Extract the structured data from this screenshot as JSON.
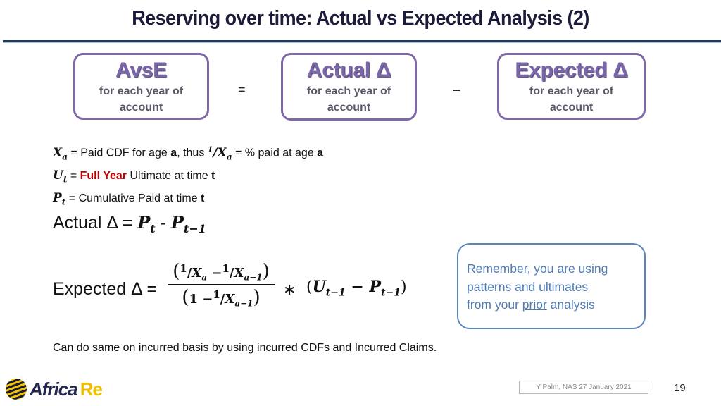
{
  "slide": {
    "title": "Reserving over time: Actual vs Expected Analysis (2)",
    "boxes": [
      {
        "title": "AvsE",
        "subtitle_line1": "for each year of",
        "subtitle_line2": "account"
      },
      {
        "title": "Actual Δ",
        "subtitle_line1": "for each year of",
        "subtitle_line2": "account"
      },
      {
        "title": "Expected Δ",
        "subtitle_line1": "for each year of",
        "subtitle_line2": "account"
      }
    ],
    "operators": {
      "equals": "=",
      "minus": "–"
    },
    "definitions": [
      {
        "symbol": "X",
        "subscript": "a",
        "text1": " = Paid CDF for age ",
        "bold1": "a",
        "text2": ", thus ",
        "frac_num": "1",
        "frac_sym": "X",
        "frac_sub": "a",
        "text3": " = % paid at age ",
        "bold2": "a"
      },
      {
        "symbol": "U",
        "subscript": "t",
        "text1": " = ",
        "highlight": "Full Year",
        "text2": " Ultimate at time ",
        "bold1": "t"
      },
      {
        "symbol": "P",
        "subscript": "t",
        "text1": " = Cumulative Paid at time ",
        "bold1": "t"
      }
    ],
    "actual_formula": {
      "label": "Actual Δ = ",
      "term1": "P",
      "term1_sub": "t",
      "op": " - ",
      "term2": "P",
      "term2_sub": "t−1"
    },
    "expected_formula": {
      "label": "Expected Δ = ",
      "numerator": {
        "open": "(",
        "one_a": "1",
        "x_a": "X",
        "sub_a": "a",
        "minus": " −",
        "one_b": "1",
        "x_b": "X",
        "sub_b": "a−1",
        "close": ")"
      },
      "denominator": {
        "open": "(",
        "one": "1",
        "minus": " −",
        "one_b": "1",
        "x": "X",
        "sub": "a−1",
        "close": ")"
      },
      "times": "∗",
      "paren": {
        "open": "(",
        "u": "U",
        "u_sub": "t−1",
        "minus": " − ",
        "p": "P",
        "p_sub": "t−1",
        "close": ")"
      }
    },
    "note": {
      "line1": "Remember, you are using",
      "line2": "patterns and ultimates",
      "line3_pre": "from your ",
      "line3_underlined": "prior",
      "line3_post": " analysis"
    },
    "footnote": "Can do same on incurred basis by using incurred CDFs and Incurred Claims.",
    "footer": {
      "logo_text_1": "Africa",
      "logo_text_2": "Re",
      "credit": "Y Palm, NAS 27 January 2021",
      "page_number": "19"
    }
  },
  "colors": {
    "title": "#1b1b3a",
    "box_border": "#7f68a8",
    "note_border": "#5b86bd",
    "note_text": "#4f7bb5",
    "highlight": "#c00000",
    "logo_gold": "#f0c000",
    "logo_navy": "#22284d"
  }
}
